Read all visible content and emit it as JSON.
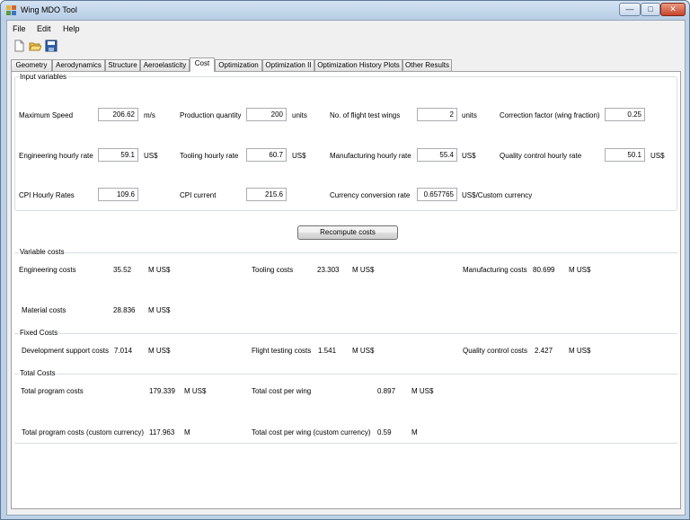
{
  "window": {
    "title": "Wing MDO Tool",
    "minimize": "—",
    "maximize": "□",
    "close": "✕"
  },
  "menu": {
    "file": "File",
    "edit": "Edit",
    "help": "Help"
  },
  "toolbar": {
    "new_icon": "new-file-icon",
    "open_icon": "open-folder-icon",
    "save_icon": "save-icon"
  },
  "tabs": [
    "Geometry",
    "Aerodynamics",
    "Structure",
    "Aeroelasticity",
    "Cost",
    "Optimization",
    "Optimization II",
    "Optimization History Plots",
    "Other Results"
  ],
  "active_tab": "Cost",
  "input_vars": {
    "legend": "Input variables",
    "max_speed": {
      "label": "Maximum Speed",
      "value": "206.62",
      "unit": "m/s"
    },
    "prod_qty": {
      "label": "Production quantity",
      "value": "200",
      "unit": "units"
    },
    "flight_test_wings": {
      "label": "No. of flight test wings",
      "value": "2",
      "unit": "units"
    },
    "correction": {
      "label": "Correction factor (wing fraction)",
      "value": "0.25"
    },
    "eng_rate": {
      "label": "Engineering hourly rate",
      "value": "59.1",
      "unit": "US$"
    },
    "tool_rate": {
      "label": "Tooling hourly rate",
      "value": "60.7",
      "unit": "US$"
    },
    "mfg_rate": {
      "label": "Manufacturing hourly rate",
      "value": "55.4",
      "unit": "US$"
    },
    "qc_rate": {
      "label": "Quality control hourly rate",
      "value": "50.1",
      "unit": "US$"
    },
    "cpi_rates": {
      "label": "CPI Hourly Rates",
      "value": "109.6"
    },
    "cpi_current": {
      "label": "CPI current",
      "value": "215.6"
    },
    "conv_rate": {
      "label": "Currency conversion rate",
      "value": "0.657765",
      "unit": "US$/Custom currency"
    }
  },
  "recompute_button": "Recompute costs",
  "variable_costs": {
    "legend": "Variable costs",
    "engineering": {
      "label": "Engineering costs",
      "value": "35.52",
      "unit": "M US$"
    },
    "tooling": {
      "label": "Tooling costs",
      "value": "23.303",
      "unit": "M US$"
    },
    "manufacturing": {
      "label": "Manufacturing costs",
      "value": "80.699",
      "unit": "M US$"
    },
    "material": {
      "label": "Material costs",
      "value": "28.836",
      "unit": "M US$"
    }
  },
  "fixed_costs": {
    "legend": "Fixed Costs",
    "dev_support": {
      "label": "Development support costs",
      "value": "7.014",
      "unit": "M US$"
    },
    "flight_testing": {
      "label": "Flight testing costs",
      "value": "1.541",
      "unit": "M US$"
    },
    "quality_control": {
      "label": "Quality control costs",
      "value": "2.427",
      "unit": "M US$"
    }
  },
  "total_costs": {
    "legend": "Total Costs",
    "program": {
      "label": "Total program costs",
      "value": "179.339",
      "unit": "M US$"
    },
    "per_wing": {
      "label": "Total cost per wing",
      "value": "0.897",
      "unit": "M US$"
    },
    "program_custom": {
      "label": "Total program costs (custom currency)",
      "value": "117.963",
      "unit": "M"
    },
    "per_wing_custom": {
      "label": "Total cost per wing (custom currency)",
      "value": "0.59",
      "unit": "M"
    }
  },
  "colors": {
    "frame": "#bcd1e6",
    "client": "#f0f0f0",
    "group_border": "#d5dfe5",
    "close_button": "#c7452a"
  }
}
